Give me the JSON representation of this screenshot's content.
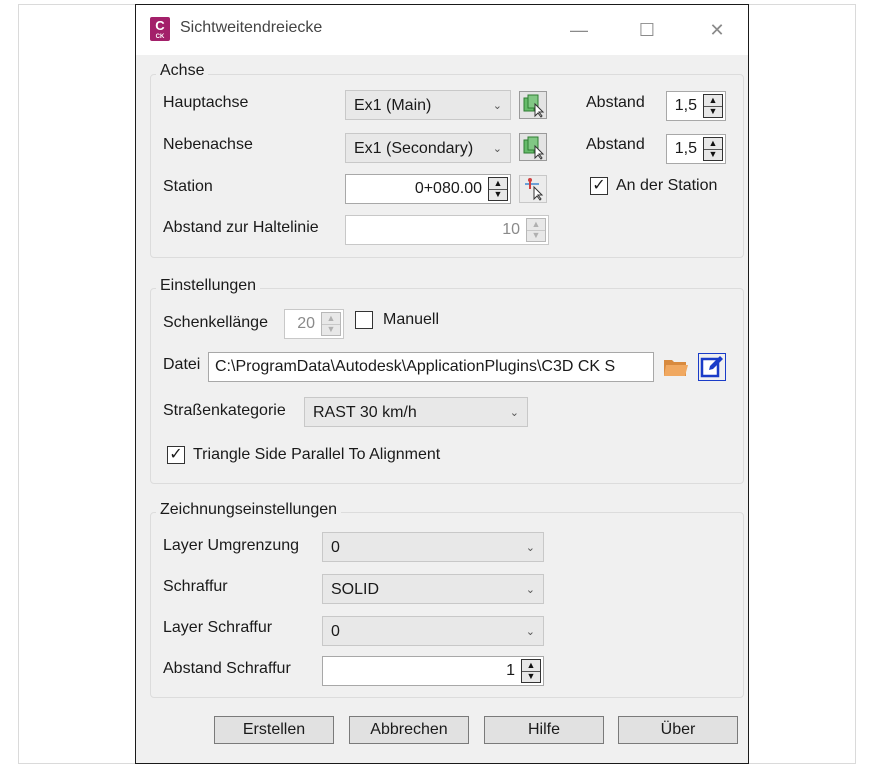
{
  "window": {
    "title": "Sichtweitendreiecke",
    "app_icon_letter": "C",
    "app_icon_sub": "CK"
  },
  "achse": {
    "label": "Achse",
    "hauptachse_label": "Hauptachse",
    "hauptachse_value": "Ex1 (Main)",
    "nebenachse_label": "Nebenachse",
    "nebenachse_value": "Ex1 (Secondary)",
    "station_label": "Station",
    "station_value": "0+080.00",
    "abstand_label": "Abstand",
    "abstand1_value": "1,5",
    "abstand2_value": "1,5",
    "an_der_station_label": "An der Station",
    "an_der_station_checked": true,
    "haltelinie_label": "Abstand zur Haltelinie",
    "haltelinie_value": "10"
  },
  "einstellungen": {
    "label": "Einstellungen",
    "schenkellaenge_label": "Schenkellänge",
    "schenkellaenge_value": "20",
    "manuell_label": "Manuell",
    "manuell_checked": false,
    "datei_label": "Datei",
    "datei_value": "C:\\ProgramData\\Autodesk\\ApplicationPlugins\\C3D CK S",
    "strassenkategorie_label": "Straßenkategorie",
    "strassenkategorie_value": "RAST 30 km/h",
    "triangle_label": "Triangle Side Parallel To Alignment",
    "triangle_checked": true
  },
  "zeichnung": {
    "label": "Zeichnungseinstellungen",
    "layer_umgrenzung_label": "Layer Umgrenzung",
    "layer_umgrenzung_value": "0",
    "schraffur_label": "Schraffur",
    "schraffur_value": "SOLID",
    "layer_schraffur_label": "Layer Schraffur",
    "layer_schraffur_value": "0",
    "abstand_schraffur_label": "Abstand Schraffur",
    "abstand_schraffur_value": "1"
  },
  "buttons": {
    "erstellen": "Erstellen",
    "abbrechen": "Abbrechen",
    "hilfe": "Hilfe",
    "ueber": "Über"
  },
  "colors": {
    "accent_app_icon": "#a3206a",
    "folder_icon": "#e0954a",
    "edit_icon": "#1a3cc8",
    "pick_icon_green": "#4caf50"
  }
}
